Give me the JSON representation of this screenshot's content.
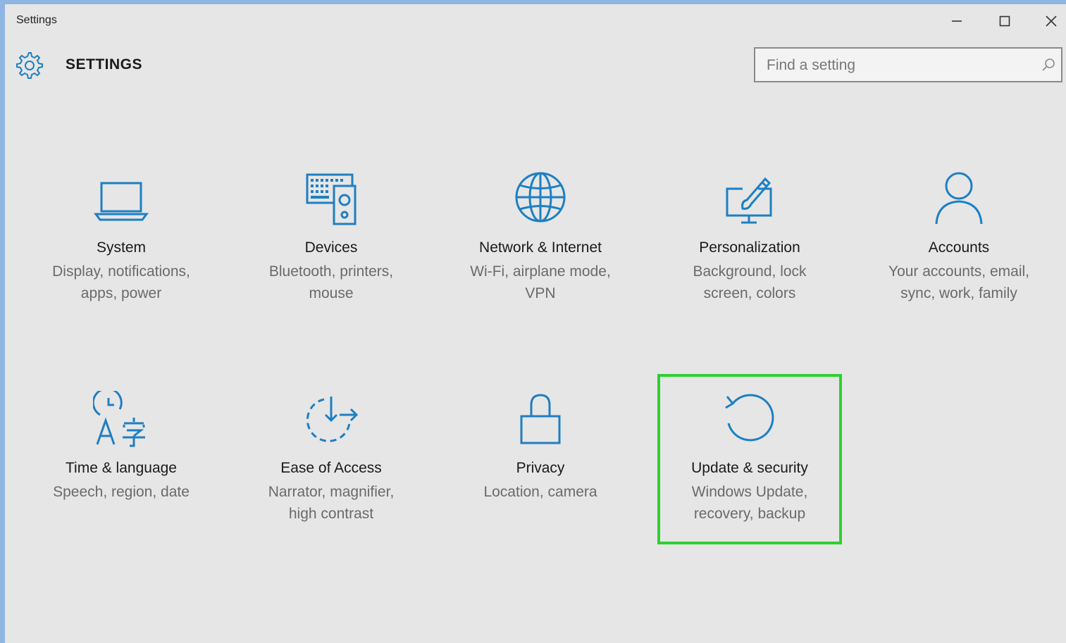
{
  "window": {
    "title": "Settings",
    "controls": {
      "minimize": "minimize-icon",
      "maximize": "maximize-icon",
      "close": "close-icon"
    }
  },
  "header": {
    "title": "SETTINGS",
    "icon": "gear-icon"
  },
  "search": {
    "placeholder": "Find a setting",
    "value": "",
    "icon": "search-icon"
  },
  "accent_color": "#1e7fc2",
  "highlight_color": "#2ed12e",
  "categories": [
    {
      "name": "System",
      "desc1": "Display, notifications,",
      "desc2": "apps, power",
      "icon": "laptop-icon"
    },
    {
      "name": "Devices",
      "desc1": "Bluetooth, printers,",
      "desc2": "mouse",
      "icon": "keyboard-speaker-icon"
    },
    {
      "name": "Network & Internet",
      "desc1": "Wi-Fi, airplane mode,",
      "desc2": "VPN",
      "icon": "globe-icon"
    },
    {
      "name": "Personalization",
      "desc1": "Background, lock",
      "desc2": "screen, colors",
      "icon": "paintbrush-monitor-icon"
    },
    {
      "name": "Accounts",
      "desc1": "Your accounts, email,",
      "desc2": "sync, work, family",
      "icon": "person-icon"
    },
    {
      "name": "Time & language",
      "desc1": "Speech, region, date",
      "desc2": "",
      "icon": "clock-language-icon"
    },
    {
      "name": "Ease of Access",
      "desc1": "Narrator, magnifier,",
      "desc2": "high contrast",
      "icon": "ease-of-access-icon"
    },
    {
      "name": "Privacy",
      "desc1": "Location, camera",
      "desc2": "",
      "icon": "lock-icon"
    },
    {
      "name": "Update & security",
      "desc1": "Windows Update,",
      "desc2": "recovery, backup",
      "icon": "refresh-icon",
      "selected": true
    }
  ]
}
